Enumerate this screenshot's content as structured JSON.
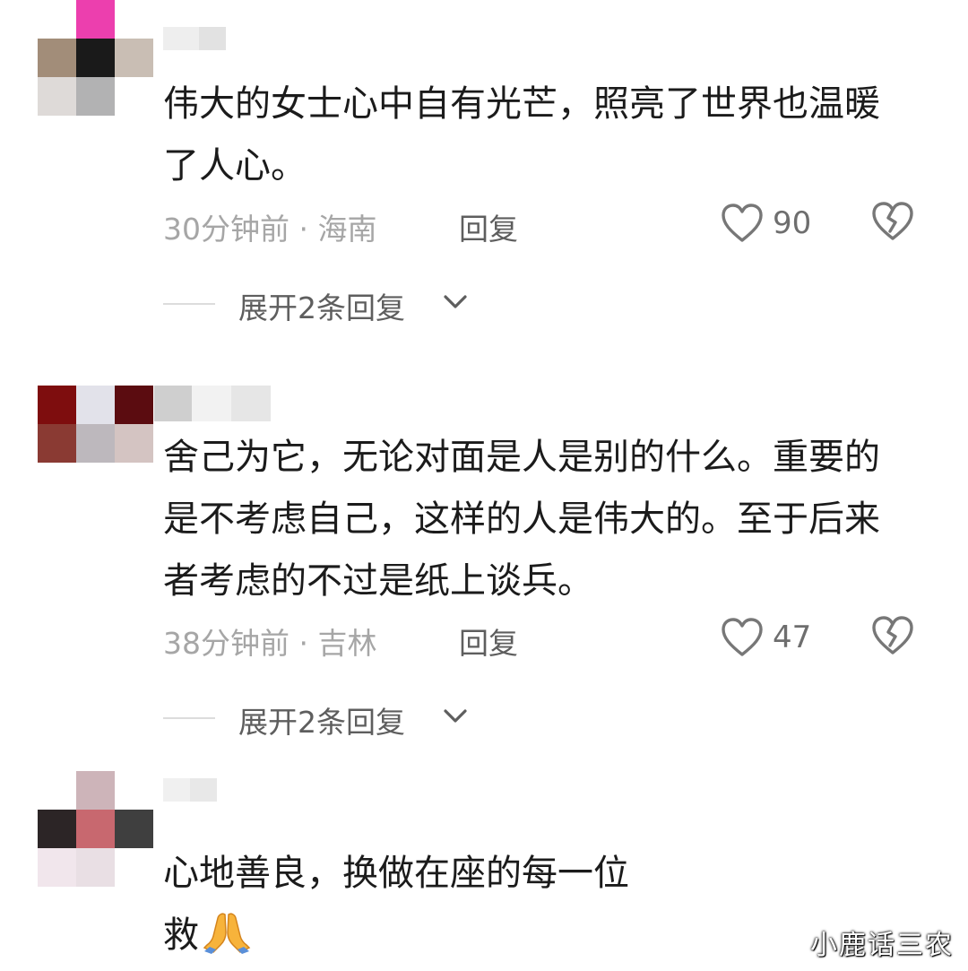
{
  "comments": [
    {
      "text": "伟大的女士心中自有光芒，照亮了世界也温暖了人心。",
      "meta": "30分钟前 · 海南",
      "reply_label": "回复",
      "like_count": "90",
      "expand_label": "展开2条回复"
    },
    {
      "text": "舍己为它，无论对面是人是别的什么。重要的是不考虑自己，这样的人是伟大的。至于后来者考虑的不过是纸上谈兵。",
      "meta": "38分钟前 · 吉林",
      "reply_label": "回复",
      "like_count": "47",
      "expand_label": "展开2条回复"
    },
    {
      "text_line1": "心地善良，换做在座的每一位",
      "text_line2": "救"
    }
  ],
  "watermark": "小鹿话三农",
  "colors": {
    "text": "#1b1b1b",
    "meta": "#a6a6a6",
    "action": "#5e5e5e",
    "icon": "#777777"
  },
  "icons": [
    "heart-icon",
    "broken-heart-icon",
    "chevron-down-icon",
    "praying-hands-emoji"
  ]
}
